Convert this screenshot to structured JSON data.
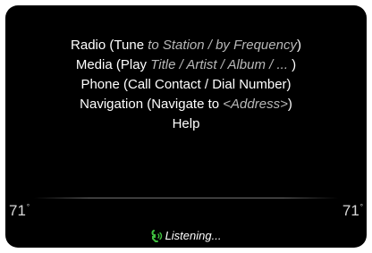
{
  "voice_commands": [
    {
      "keyword": "Radio",
      "prefix": " (Tune ",
      "hint": "to Station / by Frequency",
      "suffix": ")"
    },
    {
      "keyword": "Media",
      "prefix": " (Play ",
      "hint": "Title / Artist / Album / ...",
      "suffix": " )"
    },
    {
      "keyword": "Phone",
      "prefix": " (Call Contact / Dial Number)",
      "hint": "",
      "suffix": ""
    },
    {
      "keyword": "Navigation",
      "prefix": " (Navigate to ",
      "hint": "<Address>",
      "suffix": ")"
    },
    {
      "keyword": "Help",
      "prefix": "",
      "hint": "",
      "suffix": ""
    }
  ],
  "climate": {
    "left_temp": "71",
    "right_temp": "71",
    "unit": "°"
  },
  "status": {
    "listening_label": "Listening...",
    "icon": "voice-mic-icon",
    "icon_color": "#3fbf3f"
  },
  "colors": {
    "background": "#000000",
    "text": "#ffffff",
    "hint_text": "#b8b8b8"
  }
}
